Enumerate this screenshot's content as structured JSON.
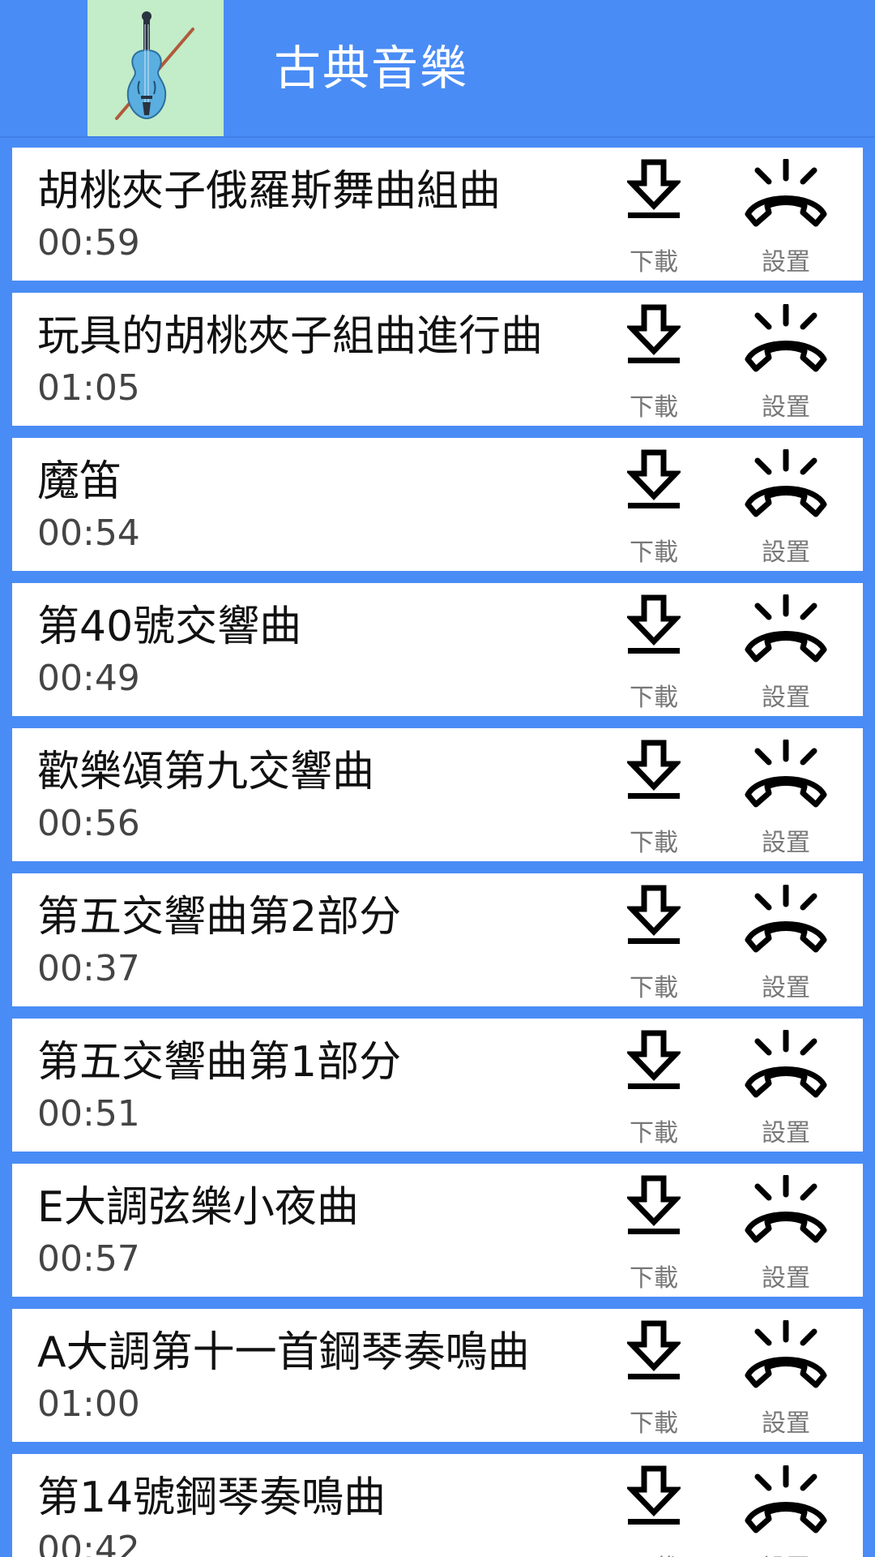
{
  "header": {
    "title": "古典音樂",
    "icon": "violin-icon"
  },
  "colors": {
    "accent": "#4a8cf5",
    "icon_bg": "#c3ecc8"
  },
  "actions": {
    "download_label": "下載",
    "settings_label": "設置",
    "download_icon": "download-icon",
    "settings_icon": "ringing-phone-icon"
  },
  "songs": [
    {
      "title": "胡桃夾子俄羅斯舞曲組曲",
      "duration": "00:59"
    },
    {
      "title": "玩具的胡桃夾子組曲進行曲",
      "duration": "01:05"
    },
    {
      "title": "魔笛",
      "duration": "00:54"
    },
    {
      "title": "第40號交響曲",
      "duration": "00:49"
    },
    {
      "title": "歡樂頌第九交響曲",
      "duration": "00:56"
    },
    {
      "title": "第五交響曲第2部分",
      "duration": "00:37"
    },
    {
      "title": "第五交響曲第1部分",
      "duration": "00:51"
    },
    {
      "title": "E大調弦樂小夜曲",
      "duration": "00:57"
    },
    {
      "title": "A大調第十一首鋼琴奏鳴曲",
      "duration": "01:00"
    },
    {
      "title": "第14號鋼琴奏鳴曲",
      "duration": "00:42"
    }
  ]
}
